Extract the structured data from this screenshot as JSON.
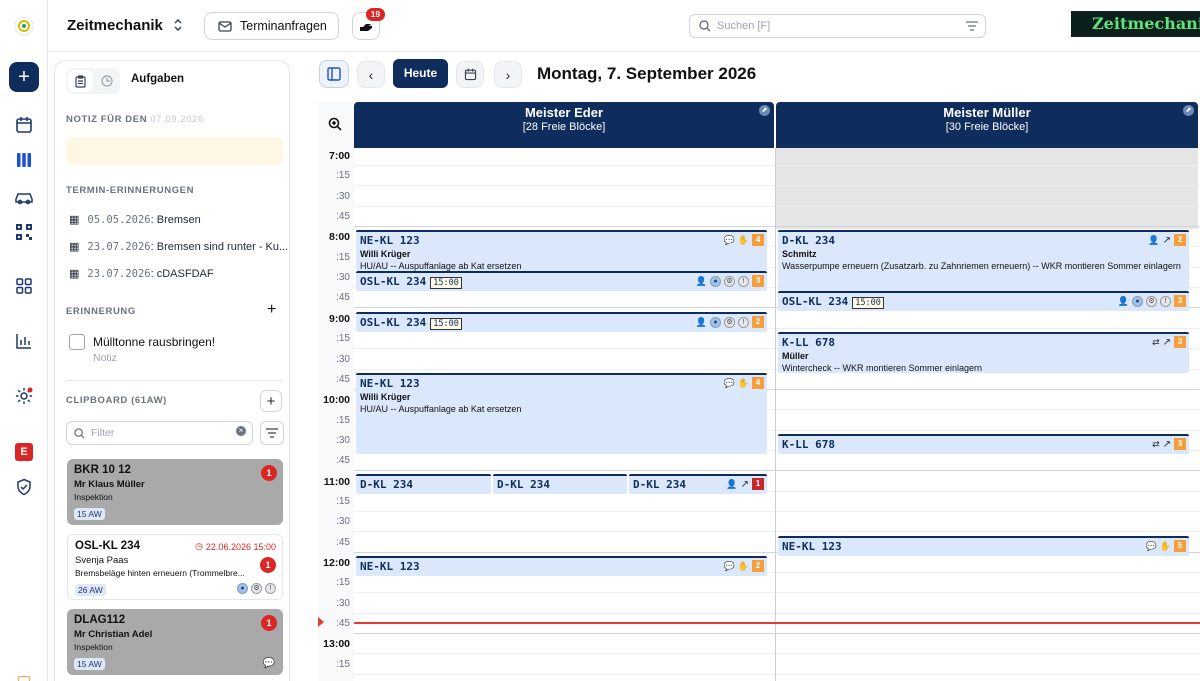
{
  "app": {
    "title": "Zeitmechanik",
    "logo_text": "Zeitmechanik"
  },
  "topbar": {
    "termin_label": "Terminanfragen",
    "notif_count": "19",
    "search_placeholder": "Suchen [F]"
  },
  "rail": {
    "items": [
      "add-icon",
      "calendar-icon",
      "columns-icon",
      "car-icon",
      "qr-icon",
      "grid-icon",
      "chart-icon",
      "settings-icon",
      "e-badge-icon",
      "shield-icon"
    ],
    "e_label": "E"
  },
  "sidebar": {
    "tab_label": "Aufgaben",
    "note_title": "NOTIZ FÜR DEN",
    "note_date": "07.09.2026",
    "reminders_title": "TERMIN-ERINNERUNGEN",
    "reminders": [
      {
        "date": "05.05.2026",
        "text": ": Bremsen"
      },
      {
        "date": "23.07.2026",
        "text": ": Bremsen sind runter - Ku..."
      },
      {
        "date": "23.07.2026",
        "text": ": cDASFDAF"
      }
    ],
    "erinnerung_title": "ERINNERUNG",
    "task": {
      "title": "Mülltonne rausbringen!",
      "sub": "Notiz"
    },
    "clipboard_title": "CLIPBOARD (61AW)",
    "filter_placeholder": "Filter",
    "cards": [
      {
        "plate": "BKR 10 12",
        "name": "Mr Klaus Müller",
        "desc": "Inspektion",
        "aw": "15 AW",
        "count": "1",
        "date": ""
      },
      {
        "plate": "OSL-KL 234",
        "name": "Svenja Paas",
        "desc": "Bremsbeläge hinten erneuern (Trommelbre...",
        "aw": "26 AW",
        "count": "1",
        "date": "22.06.2026 15:00"
      },
      {
        "plate": "DLAG112",
        "name": "Mr Christian Adel",
        "desc": "Inspektion",
        "aw": "15 AW",
        "count": "1",
        "date": ""
      }
    ]
  },
  "calendar": {
    "today_label": "Heute",
    "date_title": "Montag, 7. September 2026",
    "columns": [
      {
        "name": "Meister Eder",
        "free": "[28 Freie Blöcke]"
      },
      {
        "name": "Meister Müller",
        "free": "[30 Freie Blöcke]"
      }
    ],
    "times": [
      "7:00",
      ":15",
      ":30",
      ":45",
      "8:00",
      ":15",
      ":30",
      ":45",
      "9:00",
      ":15",
      ":30",
      ":45",
      "10:00",
      ":15",
      ":30",
      ":45",
      "11:00",
      ":15",
      ":30",
      ":45",
      "12:00",
      ":15",
      ":30",
      ":45",
      "13:00",
      ":15"
    ],
    "events_eder": [
      {
        "plate": "NE-KL 123",
        "name": "Willi Krüger",
        "desc": "HU/AU -- Auspuffanlage ab Kat ersetzen",
        "tag": "4"
      },
      {
        "plate": "OSL-KL 234",
        "time": "15:00",
        "tag": "3"
      },
      {
        "plate": "OSL-KL 234",
        "time": "15:00",
        "tag": "2"
      },
      {
        "plate": "NE-KL 123",
        "name": "Willi Krüger",
        "desc": "HU/AU -- Auspuffanlage ab Kat ersetzen",
        "tag": "4"
      },
      {
        "plate": "D-KL 234"
      },
      {
        "plate": "D-KL 234"
      },
      {
        "plate": "D-KL 234",
        "tag": "1"
      },
      {
        "plate": "NE-KL 123",
        "tag": "2"
      }
    ],
    "events_mueller": [
      {
        "plate": "D-KL 234",
        "name": "Schmitz",
        "desc": "Wasserpumpe erneuern (Zusatzarb. zu Zahnriemen erneuern) -- WKR montieren Sommer einlagern",
        "tag": "2"
      },
      {
        "plate": "OSL-KL 234",
        "time": "15:00",
        "tag": "3"
      },
      {
        "plate": "K-LL 678",
        "name": "Müller",
        "desc": "Wintercheck -- WKR montieren Sommer einlagern",
        "tag": "3"
      },
      {
        "plate": "K-LL 678",
        "tag": "3"
      },
      {
        "plate": "NE-KL 123",
        "tag": "5"
      }
    ]
  },
  "colors": {
    "navy": "#0f2d5c",
    "event_bg": "#dbe8fb",
    "orange": "#f59e3b",
    "red": "#dc2626"
  }
}
